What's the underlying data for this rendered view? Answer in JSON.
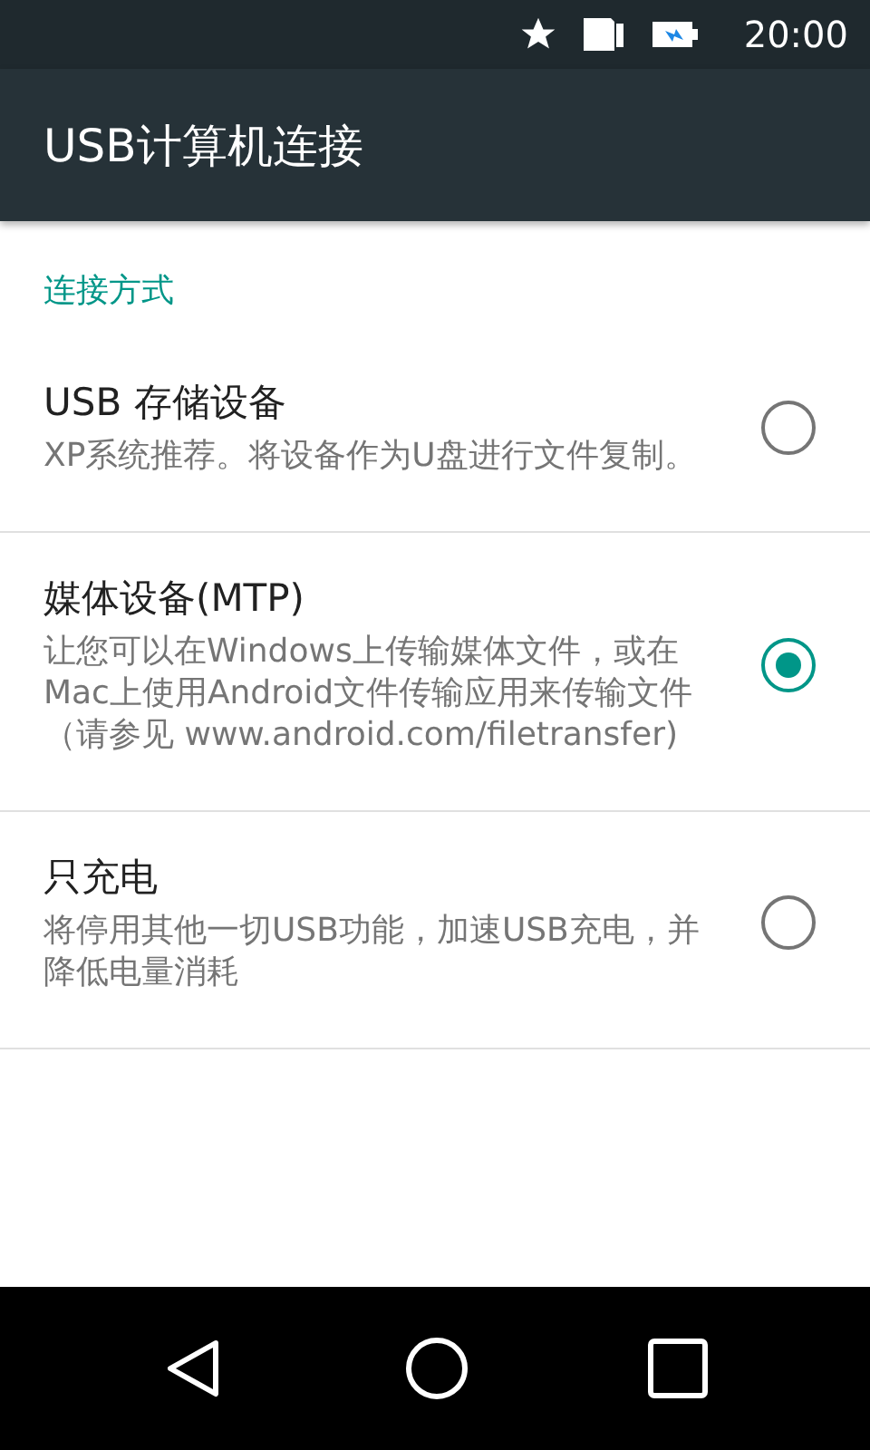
{
  "status_bar": {
    "time": "20:00"
  },
  "app_bar": {
    "title": "USB计算机连接"
  },
  "section": {
    "title": "连接方式"
  },
  "options": [
    {
      "title": "USB 存储设备",
      "summary": "XP系统推荐。将设备作为U盘进行文件复制。",
      "selected": false
    },
    {
      "title": "媒体设备(MTP)",
      "summary": "让您可以在Windows上传输媒体文件，或在Mac上使用Android文件传输应用来传输文件（请参见 www.android.com/filetransfer)",
      "selected": true
    },
    {
      "title": "只充电",
      "summary": "将停用其他一切USB功能，加速USB充电，并降低电量消耗",
      "selected": false
    }
  ]
}
